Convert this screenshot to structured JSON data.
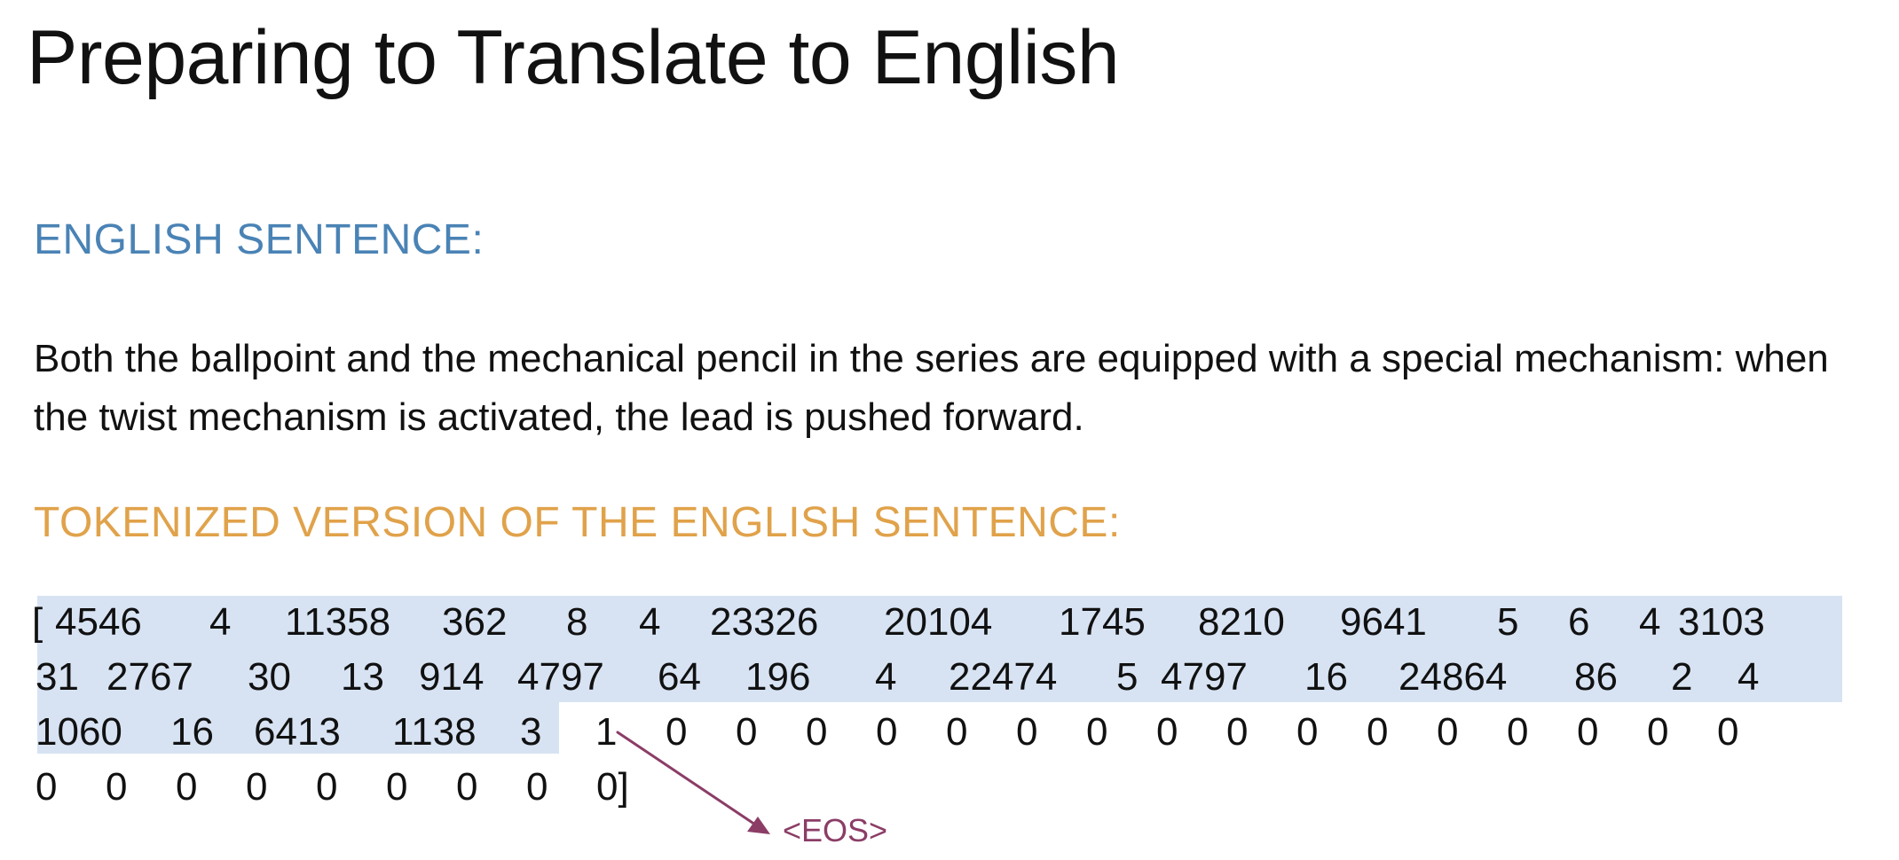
{
  "title": "Preparing to Translate to English",
  "english_heading": "ENGLISH SENTENCE:",
  "english_sentence": "Both the ballpoint and the mechanical pencil in the series are equipped with a special mechanism: when the twist mechanism is activated, the lead is pushed forward.",
  "tokenized_heading": "TOKENIZED VERSION OF THE ENGLISH SENTENCE:",
  "token_rows": [
    [
      "[",
      "4546",
      "4",
      "11358",
      "362",
      "8",
      "4",
      "23326",
      "20104",
      "1745",
      "8210",
      "9641",
      "5",
      "6",
      "4",
      "3103"
    ],
    [
      "31",
      "2767",
      "30",
      "13",
      "914",
      "4797",
      "64",
      "196",
      "4",
      "22474",
      "5",
      "4797",
      "16",
      "24864",
      "86",
      "2",
      "4"
    ],
    [
      "1060",
      "16",
      "6413",
      "1138",
      "3",
      "1",
      "0",
      "0",
      "0",
      "0",
      "0",
      "0",
      "0",
      "0",
      "0",
      "0",
      "0",
      "0",
      "0",
      "0",
      "0",
      "0"
    ],
    [
      "0",
      "0",
      "0",
      "0",
      "0",
      "0",
      "0",
      "0",
      "0]"
    ]
  ],
  "eos_label": "<EOS>",
  "colors": {
    "heading_english": "#4a83b5",
    "heading_tokenized": "#e0a24a",
    "highlight": "#d7e3f3",
    "eos": "#8b3d66",
    "text": "#111111"
  }
}
